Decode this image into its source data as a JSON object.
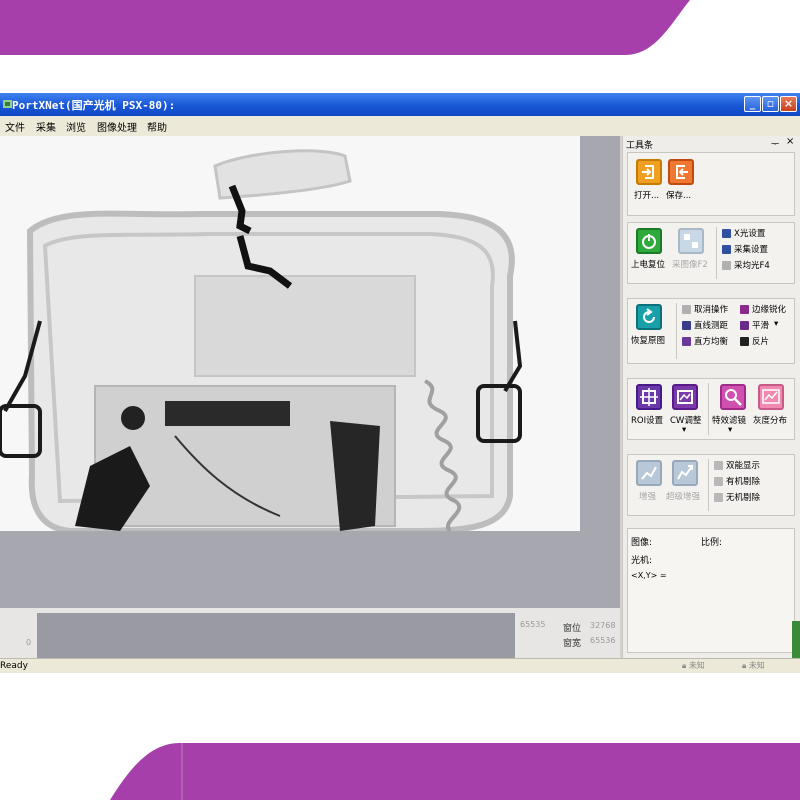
{
  "colors": {
    "brand_purple": "#a63faa",
    "titlebar_blue": "#1a57d6",
    "viewer_gray": "#a7a7af"
  },
  "window": {
    "title": "PortXNet(国产光机 PSX-80):"
  },
  "menu": {
    "items": [
      "文件",
      "采集",
      "浏览",
      "图像处理",
      "帮助"
    ]
  },
  "toolbar_panel": {
    "title": "工具条",
    "pin_glyph": "ᅮ",
    "close_glyph": "×",
    "file_group": {
      "open_label": "打开...",
      "save_label": "保存..."
    },
    "acquire_group": {
      "power_reset_label": "上电复位",
      "capture_label": "采图像F2",
      "xray_settings_label": "X光设置",
      "capture_settings_label": "采集设置",
      "calibrate_label": "采均光F4"
    },
    "process_group": {
      "restore_label": "恢复原图",
      "undo_label": "取消操作",
      "edge_sharpen_label": "边缘锐化",
      "line_measure_label": "直线测距",
      "smooth_label": "平滑",
      "hist_equalize_label": "直方均衡",
      "invert_label": "反片"
    },
    "analysis_group": {
      "roi_label": "ROI设置",
      "cw_label": "CW调整",
      "effects_label": "特效滤镜",
      "gray_dist_label": "灰度分布"
    },
    "enhance_group": {
      "enhance_label": "增强",
      "super_enhance_label": "超级增强",
      "dual_display_label": "双能显示",
      "organic_remove_label": "有机剔除",
      "inorganic_remove_label": "无机剔除"
    },
    "info": {
      "image_label": "图像:",
      "scale_label": "比例:",
      "machine_label": "光机:",
      "coord_label": "<X,Y> ="
    }
  },
  "histogram": {
    "min_value": "0",
    "max_value": "65535",
    "window_level_label": "窗位",
    "window_level_value": "32768",
    "window_width_label": "窗宽",
    "window_width_value": "65536"
  },
  "status": {
    "text": "Ready",
    "slot1": "未知",
    "slot2": "未知"
  }
}
